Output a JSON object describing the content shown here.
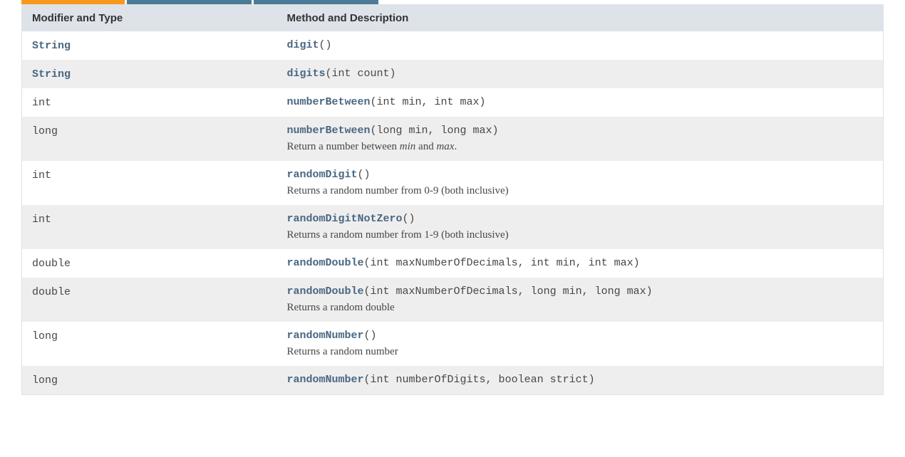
{
  "headers": {
    "modifier": "Modifier and Type",
    "method": "Method and Description"
  },
  "rows": [
    {
      "type": "String",
      "typeIsLink": true,
      "method": "digit",
      "params": "()",
      "description": ""
    },
    {
      "type": "String",
      "typeIsLink": true,
      "method": "digits",
      "params": "(int count)",
      "description": ""
    },
    {
      "type": "int",
      "typeIsLink": false,
      "method": "numberBetween",
      "params": "(int min, int max)",
      "description": ""
    },
    {
      "type": "long",
      "typeIsLink": false,
      "method": "numberBetween",
      "params": "(long min, long max)",
      "description": "Return a number between <em>min</em> and <em>max</em>."
    },
    {
      "type": "int",
      "typeIsLink": false,
      "method": "randomDigit",
      "params": "()",
      "description": "Returns a random number from 0-9 (both inclusive)"
    },
    {
      "type": "int",
      "typeIsLink": false,
      "method": "randomDigitNotZero",
      "params": "()",
      "description": "Returns a random number from 1-9 (both inclusive)"
    },
    {
      "type": "double",
      "typeIsLink": false,
      "method": "randomDouble",
      "params": "(int maxNumberOfDecimals, int min, int max)",
      "description": ""
    },
    {
      "type": "double",
      "typeIsLink": false,
      "method": "randomDouble",
      "params": "(int maxNumberOfDecimals, long min, long max)",
      "description": "Returns a random double"
    },
    {
      "type": "long",
      "typeIsLink": false,
      "method": "randomNumber",
      "params": "()",
      "description": "Returns a random number"
    },
    {
      "type": "long",
      "typeIsLink": false,
      "method": "randomNumber",
      "params": "(int numberOfDigits, boolean strict)",
      "description": ""
    }
  ]
}
